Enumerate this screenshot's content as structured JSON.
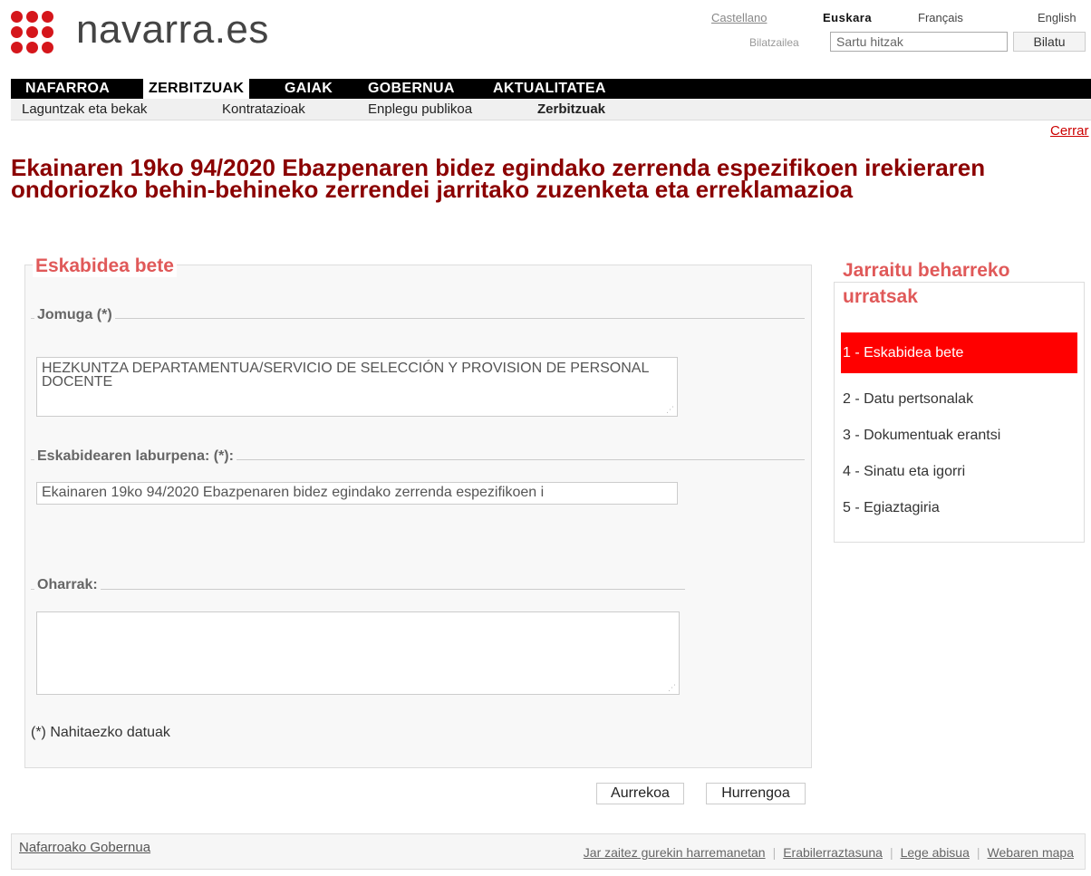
{
  "header": {
    "logo_text": "navarra.es",
    "languages": [
      "Castellano",
      "Euskara",
      "Français",
      "English"
    ],
    "search_label": "Bilatzailea",
    "search_placeholder": "Sartu hitzak",
    "search_button": "Bilatu"
  },
  "nav": {
    "main": [
      "NAFARROA",
      "ZERBITZUAK",
      "GAIAK",
      "GOBERNUA",
      "AKTUALITATEA"
    ],
    "active_main": "ZERBITZUAK",
    "sub": [
      "Laguntzak eta bekak",
      "Kontratazioak",
      "Enplegu publikoa",
      "Zerbitzuak"
    ]
  },
  "close_link": "Cerrar",
  "page_title": "Ekainaren 19ko 94/2020 Ebazpenaren bidez egindako zerrenda espezifikoen irekieraren ondoriozko behin-behineko zerrendei jarritako zuzenketa eta erreklamazioa",
  "form": {
    "legend": "Eskabidea bete",
    "fields": {
      "jomuga_label": "Jomuga (*)",
      "jomuga_value": "HEZKUNTZA DEPARTAMENTUA/SERVICIO DE SELECCIÓN Y PROVISION DE PERSONAL DOCENTE",
      "laburpena_label": "Eskabidearen laburpena: (*):",
      "laburpena_value": "Ekainaren 19ko 94/2020 Ebazpenaren bidez egindako zerrenda espezifikoen i",
      "oharrak_label": "Oharrak:",
      "oharrak_value": ""
    },
    "required_note": "(*) Nahitaezko datuak",
    "buttons": {
      "prev": "Aurrekoa",
      "next": "Hurrengoa"
    }
  },
  "steps": {
    "title": "Jarraitu beharreko urratsak",
    "items": [
      "1 - Eskabidea bete",
      "2 - Datu pertsonalak",
      "3 - Dokumentuak erantsi",
      "4 - Sinatu eta igorri",
      "5 - Egiaztagiria"
    ],
    "active_index": 0
  },
  "footer": {
    "left_link": "Nafarroako Gobernua",
    "links": [
      "Jar zaitez gurekin harremanetan",
      "Erabilerraztasuna",
      "Lege abisua",
      "Webaren mapa"
    ]
  },
  "colors": {
    "brand_red": "#d5161b",
    "title_red": "#8b0000",
    "legend_red": "#e05959",
    "active_step_bg": "#ff0000"
  }
}
